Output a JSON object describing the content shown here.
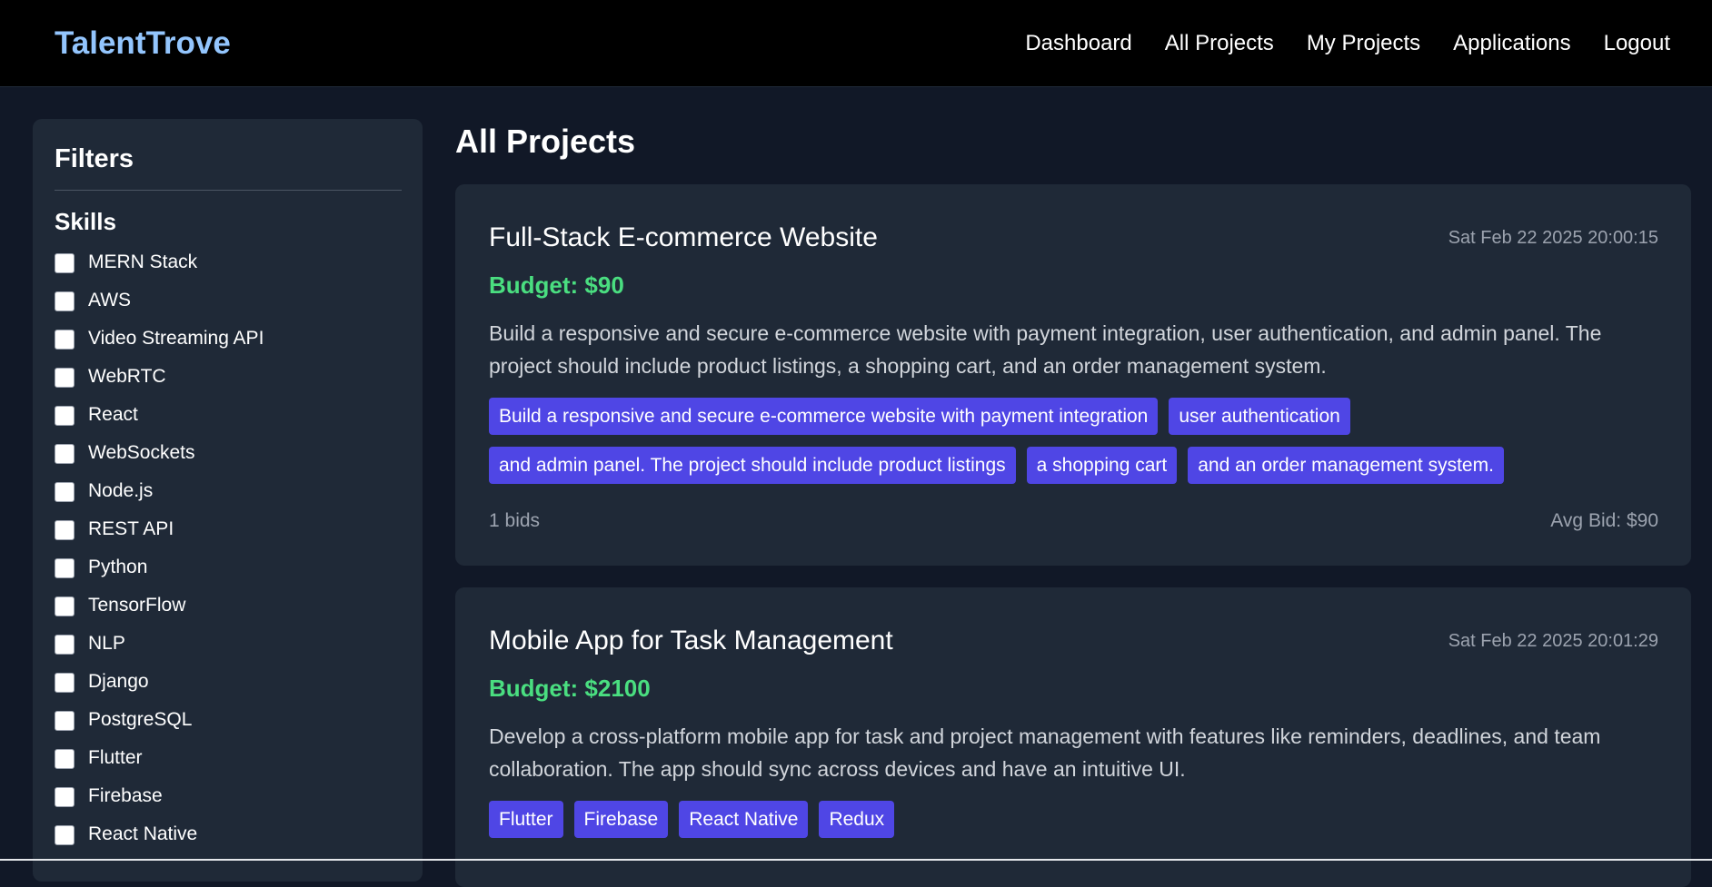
{
  "nav": {
    "brand": "TalentTrove",
    "links": [
      "Dashboard",
      "All Projects",
      "My Projects",
      "Applications",
      "Logout"
    ]
  },
  "sidebar": {
    "title": "Filters",
    "skills_title": "Skills",
    "skills": [
      "MERN Stack",
      "AWS",
      "Video Streaming API",
      "WebRTC",
      "React",
      "WebSockets",
      "Node.js",
      "REST API",
      "Python",
      "TensorFlow",
      "NLP",
      "Django",
      "PostgreSQL",
      "Flutter",
      "Firebase",
      "React Native"
    ]
  },
  "main": {
    "title": "All Projects",
    "projects": [
      {
        "title": "Full-Stack E-commerce Website",
        "date": "Sat Feb 22 2025 20:00:15",
        "budget": "Budget: $90",
        "description": "Build a responsive and secure e-commerce website with payment integration, user authentication, and admin panel. The project should include product listings, a shopping cart, and an order management system.",
        "tags": [
          "Build a responsive and secure e-commerce website with payment integration",
          "user authentication",
          "and admin panel. The project should include product listings",
          "a shopping cart",
          "and an order management system."
        ],
        "bids": "1 bids",
        "avg_bid": "Avg Bid: $90"
      },
      {
        "title": "Mobile App for Task Management",
        "date": "Sat Feb 22 2025 20:01:29",
        "budget": "Budget: $2100",
        "description": "Develop a cross-platform mobile app for task and project management with features like reminders, deadlines, and team collaboration. The app should sync across devices and have an intuitive UI.",
        "tags": [
          "Flutter",
          "Firebase",
          "React Native",
          "Redux"
        ]
      }
    ]
  },
  "colors": {
    "background": "#111827",
    "card": "#1f2937",
    "brand": "#93c5fd",
    "budget": "#4ade80",
    "tag": "#4f46e5"
  }
}
